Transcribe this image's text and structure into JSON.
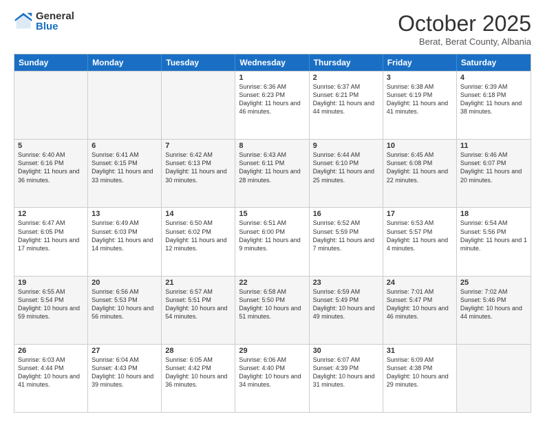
{
  "logo": {
    "general": "General",
    "blue": "Blue"
  },
  "header": {
    "month": "October 2025",
    "location": "Berat, Berat County, Albania"
  },
  "days": [
    "Sunday",
    "Monday",
    "Tuesday",
    "Wednesday",
    "Thursday",
    "Friday",
    "Saturday"
  ],
  "rows": [
    [
      {
        "num": "",
        "info": ""
      },
      {
        "num": "",
        "info": ""
      },
      {
        "num": "",
        "info": ""
      },
      {
        "num": "1",
        "info": "Sunrise: 6:36 AM\nSunset: 6:23 PM\nDaylight: 11 hours and 46 minutes."
      },
      {
        "num": "2",
        "info": "Sunrise: 6:37 AM\nSunset: 6:21 PM\nDaylight: 11 hours and 44 minutes."
      },
      {
        "num": "3",
        "info": "Sunrise: 6:38 AM\nSunset: 6:19 PM\nDaylight: 11 hours and 41 minutes."
      },
      {
        "num": "4",
        "info": "Sunrise: 6:39 AM\nSunset: 6:18 PM\nDaylight: 11 hours and 38 minutes."
      }
    ],
    [
      {
        "num": "5",
        "info": "Sunrise: 6:40 AM\nSunset: 6:16 PM\nDaylight: 11 hours and 36 minutes."
      },
      {
        "num": "6",
        "info": "Sunrise: 6:41 AM\nSunset: 6:15 PM\nDaylight: 11 hours and 33 minutes."
      },
      {
        "num": "7",
        "info": "Sunrise: 6:42 AM\nSunset: 6:13 PM\nDaylight: 11 hours and 30 minutes."
      },
      {
        "num": "8",
        "info": "Sunrise: 6:43 AM\nSunset: 6:11 PM\nDaylight: 11 hours and 28 minutes."
      },
      {
        "num": "9",
        "info": "Sunrise: 6:44 AM\nSunset: 6:10 PM\nDaylight: 11 hours and 25 minutes."
      },
      {
        "num": "10",
        "info": "Sunrise: 6:45 AM\nSunset: 6:08 PM\nDaylight: 11 hours and 22 minutes."
      },
      {
        "num": "11",
        "info": "Sunrise: 6:46 AM\nSunset: 6:07 PM\nDaylight: 11 hours and 20 minutes."
      }
    ],
    [
      {
        "num": "12",
        "info": "Sunrise: 6:47 AM\nSunset: 6:05 PM\nDaylight: 11 hours and 17 minutes."
      },
      {
        "num": "13",
        "info": "Sunrise: 6:49 AM\nSunset: 6:03 PM\nDaylight: 11 hours and 14 minutes."
      },
      {
        "num": "14",
        "info": "Sunrise: 6:50 AM\nSunset: 6:02 PM\nDaylight: 11 hours and 12 minutes."
      },
      {
        "num": "15",
        "info": "Sunrise: 6:51 AM\nSunset: 6:00 PM\nDaylight: 11 hours and 9 minutes."
      },
      {
        "num": "16",
        "info": "Sunrise: 6:52 AM\nSunset: 5:59 PM\nDaylight: 11 hours and 7 minutes."
      },
      {
        "num": "17",
        "info": "Sunrise: 6:53 AM\nSunset: 5:57 PM\nDaylight: 11 hours and 4 minutes."
      },
      {
        "num": "18",
        "info": "Sunrise: 6:54 AM\nSunset: 5:56 PM\nDaylight: 11 hours and 1 minute."
      }
    ],
    [
      {
        "num": "19",
        "info": "Sunrise: 6:55 AM\nSunset: 5:54 PM\nDaylight: 10 hours and 59 minutes."
      },
      {
        "num": "20",
        "info": "Sunrise: 6:56 AM\nSunset: 5:53 PM\nDaylight: 10 hours and 56 minutes."
      },
      {
        "num": "21",
        "info": "Sunrise: 6:57 AM\nSunset: 5:51 PM\nDaylight: 10 hours and 54 minutes."
      },
      {
        "num": "22",
        "info": "Sunrise: 6:58 AM\nSunset: 5:50 PM\nDaylight: 10 hours and 51 minutes."
      },
      {
        "num": "23",
        "info": "Sunrise: 6:59 AM\nSunset: 5:49 PM\nDaylight: 10 hours and 49 minutes."
      },
      {
        "num": "24",
        "info": "Sunrise: 7:01 AM\nSunset: 5:47 PM\nDaylight: 10 hours and 46 minutes."
      },
      {
        "num": "25",
        "info": "Sunrise: 7:02 AM\nSunset: 5:46 PM\nDaylight: 10 hours and 44 minutes."
      }
    ],
    [
      {
        "num": "26",
        "info": "Sunrise: 6:03 AM\nSunset: 4:44 PM\nDaylight: 10 hours and 41 minutes."
      },
      {
        "num": "27",
        "info": "Sunrise: 6:04 AM\nSunset: 4:43 PM\nDaylight: 10 hours and 39 minutes."
      },
      {
        "num": "28",
        "info": "Sunrise: 6:05 AM\nSunset: 4:42 PM\nDaylight: 10 hours and 36 minutes."
      },
      {
        "num": "29",
        "info": "Sunrise: 6:06 AM\nSunset: 4:40 PM\nDaylight: 10 hours and 34 minutes."
      },
      {
        "num": "30",
        "info": "Sunrise: 6:07 AM\nSunset: 4:39 PM\nDaylight: 10 hours and 31 minutes."
      },
      {
        "num": "31",
        "info": "Sunrise: 6:09 AM\nSunset: 4:38 PM\nDaylight: 10 hours and 29 minutes."
      },
      {
        "num": "",
        "info": ""
      }
    ]
  ]
}
